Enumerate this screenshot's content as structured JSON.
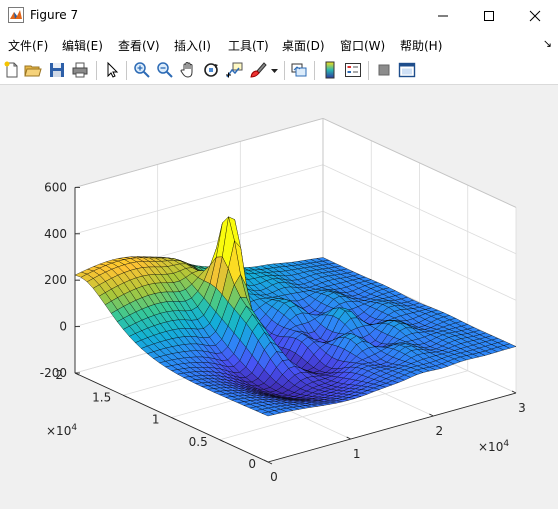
{
  "window": {
    "title": "Figure 7"
  },
  "menu": [
    "文件(F)",
    "编辑(E)",
    "查看(V)",
    "插入(I)",
    "工具(T)",
    "桌面(D)",
    "窗口(W)",
    "帮助(H)"
  ],
  "menu_overflow": "↘",
  "toolbar": [
    "new-figure",
    "open-file",
    "save",
    "print",
    "edit-plot-arrow",
    "zoom-in",
    "zoom-out",
    "pan",
    "rotate-3d",
    "data-cursor",
    "brush",
    "brush-dropdown",
    "link-plot",
    "insert-colorbar",
    "insert-legend",
    "hide-plot-tools",
    "show-plot-tools"
  ],
  "chart_data": {
    "type": "surface",
    "x_ticks": [
      "0",
      "1",
      "2",
      "3"
    ],
    "y_ticks": [
      "0",
      "0.5",
      "1",
      "1.5",
      "2"
    ],
    "z_ticks": [
      "-200",
      "0",
      "200",
      "400",
      "600"
    ],
    "x_exponent": "×10",
    "x_exponent_power": "4",
    "y_exponent": "×10",
    "y_exponent_power": "4",
    "xlim": [
      0,
      30000
    ],
    "ylim": [
      0,
      20000
    ],
    "zlim": [
      -200,
      600
    ],
    "colormap": "parula",
    "grid": true
  }
}
